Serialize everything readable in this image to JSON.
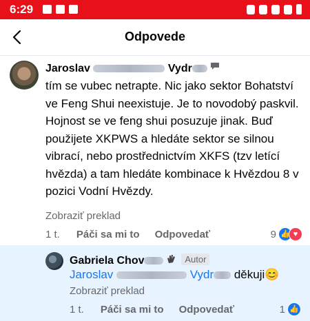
{
  "status_bar": {
    "time": "6:29",
    "bg_color": "#e8111a"
  },
  "header": {
    "title": "Odpovede",
    "back_icon": "arrow-left-icon"
  },
  "comment": {
    "author_first": "Jaroslav",
    "author_last": "Vydr",
    "text_lines": [
      "tím se vubec netrapte. Nic jako sektor Bohatství ve Feng Shui neexistuje. Je to novodobý paskvil.",
      "Hojnost se ve feng shui posuzuje jinak.  Buď použijete XKPWS a hledáte sektor se silnou vibrací, nebo prostřednictvím XKFS (tzv letící hvězda) a tam hledáte kombinace k Hvězdou 8 v pozici Vodní Hvězdy."
    ],
    "translate": "Zobraziť preklad",
    "time": "1 t.",
    "like": "Páči sa mi to",
    "reply": "Odpovedať",
    "reactions_count": "9"
  },
  "reply": {
    "author_first": "Gabriela",
    "author_last": "Chov",
    "badge": "Autor",
    "mention_first": "Jaroslav",
    "mention_last": "Vydr",
    "text": "děkuji",
    "emoji": "😊",
    "translate": "Zobraziť preklad",
    "time": "1 t.",
    "like": "Páči sa mi to",
    "reply": "Odpovedať",
    "reactions_count": "1",
    "bg_color": "#e7f3ff"
  }
}
